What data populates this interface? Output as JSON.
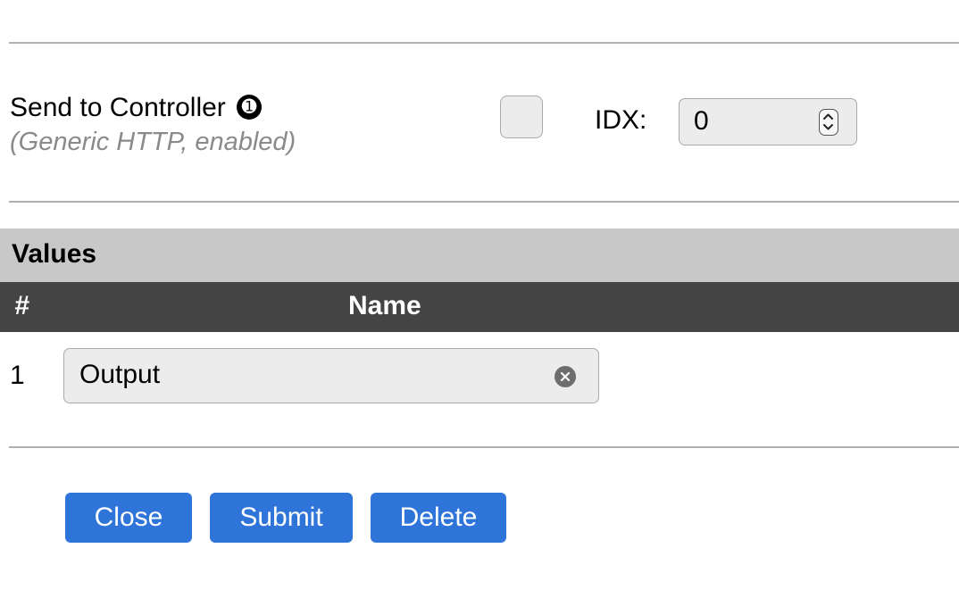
{
  "controller": {
    "label": "Send to Controller",
    "info_glyph": "➊",
    "subtitle": "(Generic HTTP, enabled)",
    "enabled_checked": false,
    "idx_label": "IDX:",
    "idx_value": "0"
  },
  "values": {
    "section_title": "Values",
    "columns": [
      "#",
      "Name"
    ],
    "rows": [
      {
        "num": "1",
        "name": "Output"
      }
    ]
  },
  "buttons": {
    "close": "Close",
    "submit": "Submit",
    "delete": "Delete"
  },
  "icons": {
    "info": "info-icon",
    "spinner": "spinner-icon",
    "clear": "clear-icon"
  },
  "colors": {
    "button_bg": "#2f74d8",
    "section_header_bg": "#c8c8c8",
    "table_header_bg": "#444444",
    "subtitle_text": "#8a8a8a"
  }
}
